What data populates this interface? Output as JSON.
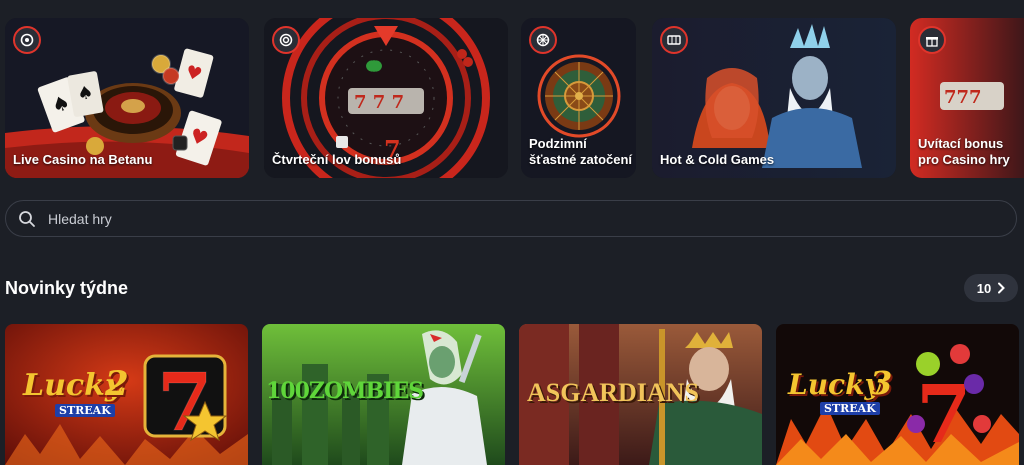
{
  "promos": [
    {
      "label": "Live Casino na Betanu",
      "icon": "chip-icon"
    },
    {
      "label": "Čtvrteční lov bonusů",
      "icon": "target-icon"
    },
    {
      "label": "Podzimní\nšťastné zatočení",
      "icon": "wheel-icon"
    },
    {
      "label": "Hot & Cold Games",
      "icon": "slot-icon"
    },
    {
      "label": "Uvítací bonus\npro Casino hry",
      "icon": "gift-icon"
    }
  ],
  "search": {
    "placeholder": "Hledat hry"
  },
  "section": {
    "title": "Novinky týdne",
    "count": "10"
  },
  "games": [
    {
      "name": "Lucky 2 Streak",
      "logo_main": "Lucky",
      "logo_num": "2",
      "logo_sub": "STREAK"
    },
    {
      "name": "100 Zombies",
      "logo_main": "100ZOMBIES"
    },
    {
      "name": "Asgardians",
      "logo_main": "ASGARDIANS"
    },
    {
      "name": "Lucky 3 Streak",
      "logo_main": "Lucky",
      "logo_num": "3",
      "logo_sub": "STREAK"
    }
  ],
  "colors": {
    "accent": "#e0342b",
    "background": "#1c1f26",
    "card": "#14161f"
  }
}
